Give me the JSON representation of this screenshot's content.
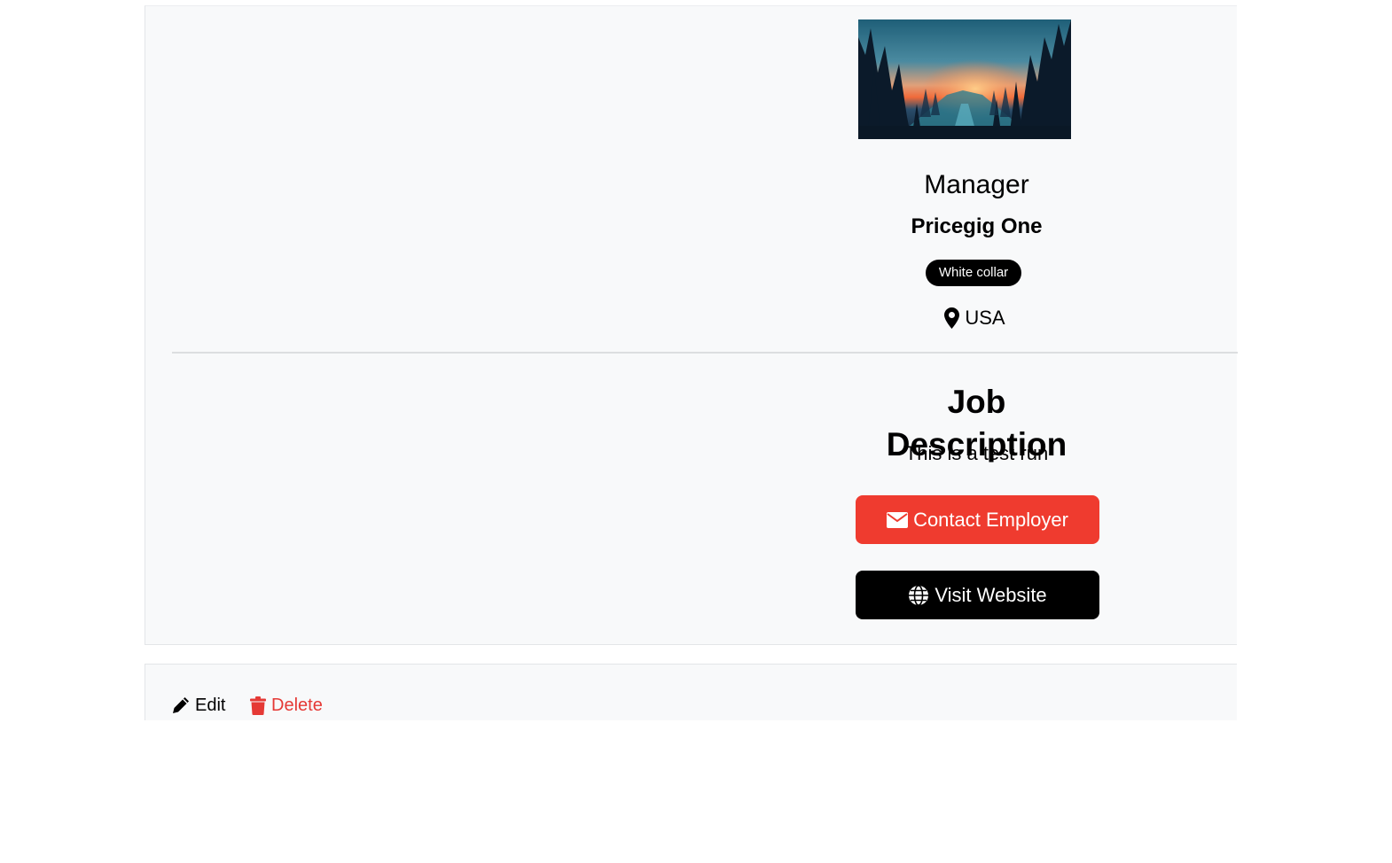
{
  "job": {
    "title": "Manager",
    "company": "Pricegig One",
    "category_badge": "White collar",
    "location": "USA",
    "description_heading": "Job Description",
    "description": "This is a test run"
  },
  "buttons": {
    "contact_label": "Contact Employer",
    "website_label": "Visit Website"
  },
  "actions": {
    "edit_label": "Edit",
    "delete_label": "Delete"
  },
  "icons": {
    "location": "map-marker-icon",
    "contact": "envelope-icon",
    "website": "globe-icon",
    "edit": "pencil-icon",
    "delete": "trash-icon"
  },
  "colors": {
    "contact_button": "#ef3b2f",
    "website_button": "#000000",
    "badge": "#000000",
    "delete_text": "#e53935",
    "card_background": "#f8f9fa"
  }
}
